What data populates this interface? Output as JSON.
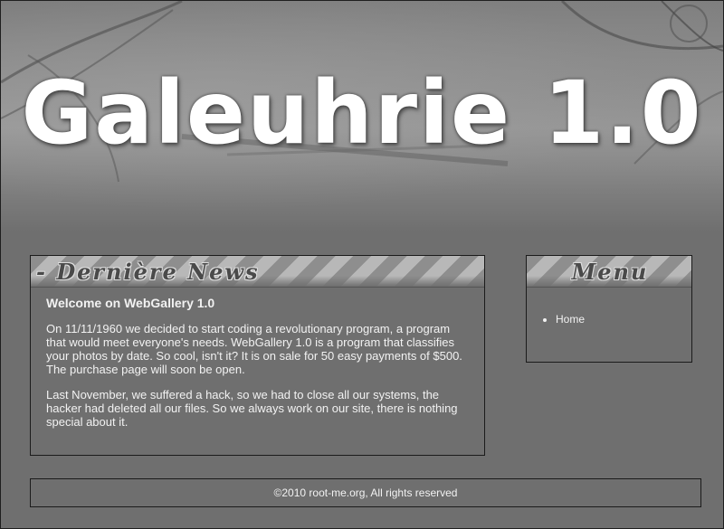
{
  "site": {
    "title": "Galeuhrie 1.0"
  },
  "news": {
    "section_title": "- Dernière News",
    "heading": "Welcome on WebGallery 1.0",
    "paragraphs": [
      "On 11/11/1960 we decided to start coding a revolutionary program, a program that would meet everyone's needs. WebGallery 1.0 is a program that classifies your photos by date. So cool, isn't it? It is on sale for 50 easy payments of $500. The purchase page will soon be open.",
      "Last November, we suffered a hack, so we had to close all our systems, the hacker had deleted all our files. So we always work on our site, there is nothing special about it."
    ]
  },
  "menu": {
    "section_title": "Menu",
    "items": [
      {
        "label": "Home"
      }
    ]
  },
  "footer": {
    "copyright": "©2010 root-me.org, All rights reserved"
  }
}
